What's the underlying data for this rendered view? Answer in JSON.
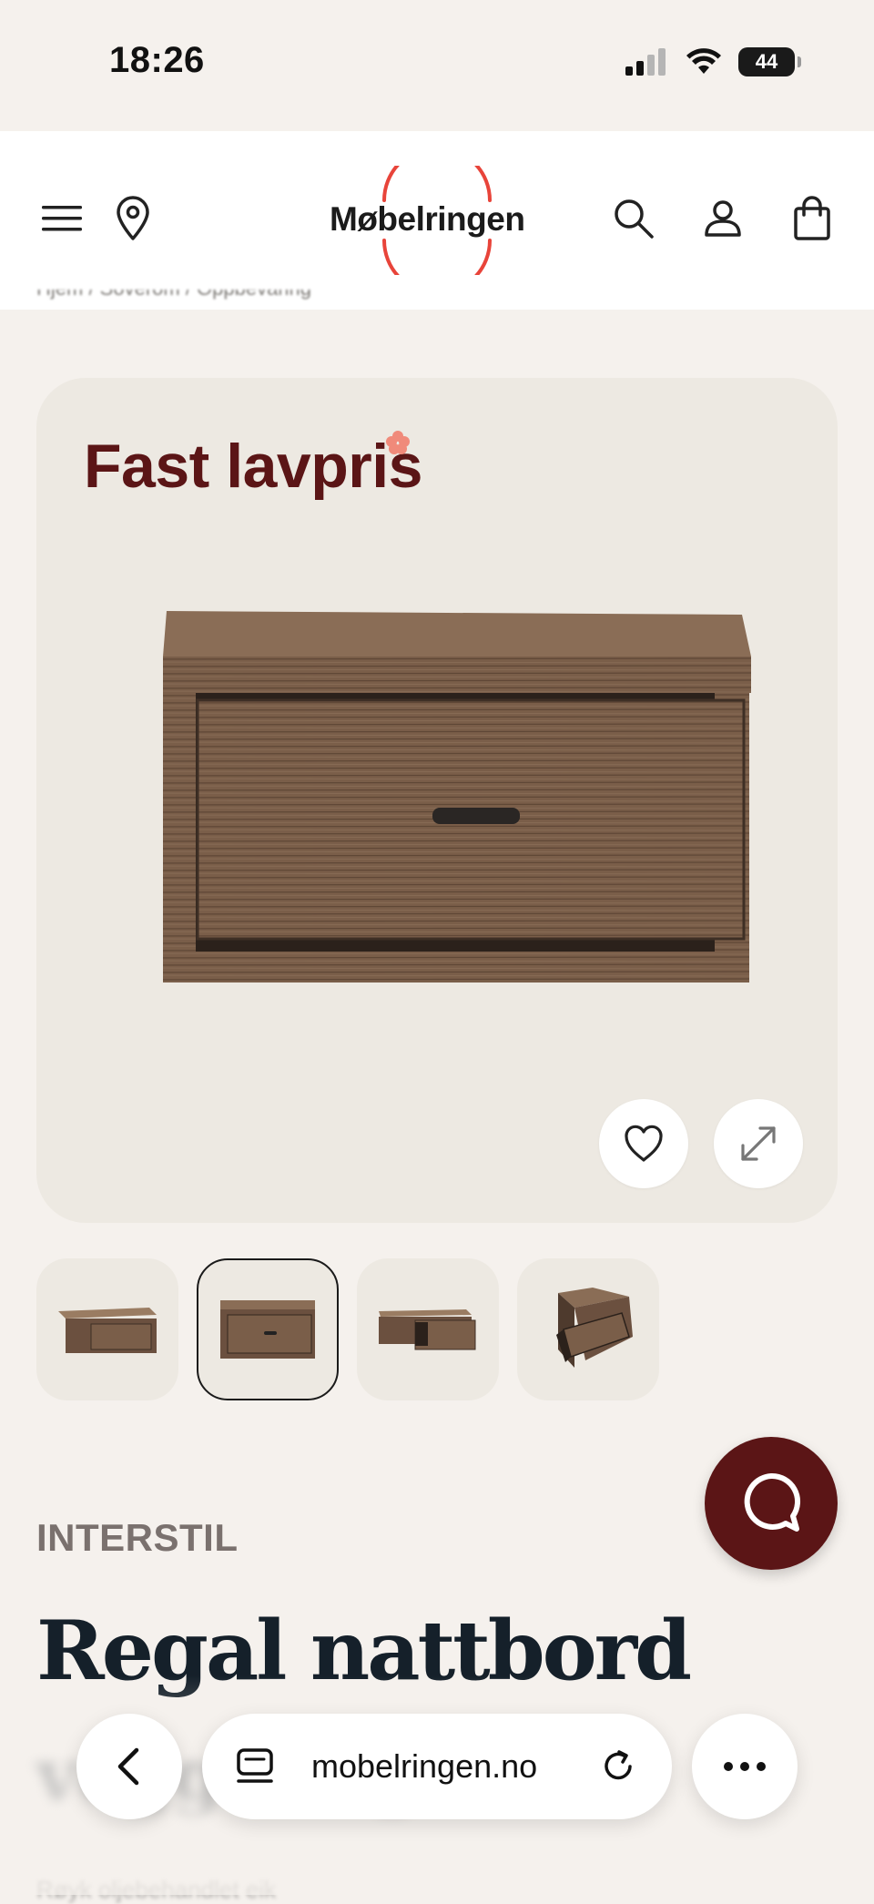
{
  "status_bar": {
    "time": "18:26",
    "battery": "44",
    "icons": [
      "cellular-signal-icon",
      "wifi-icon",
      "battery-icon"
    ]
  },
  "header": {
    "logo_text": "Møbelringen",
    "logo_ring_color": "#e8443a",
    "icons": [
      "menu-icon",
      "location-pin-icon",
      "search-icon",
      "account-icon",
      "shopping-bag-icon"
    ]
  },
  "breadcrumb": {
    "text": "Hjem / Soverom / Oppbevaring"
  },
  "gallery": {
    "badge": "Fast lavpris",
    "badge_color": "#5b1516",
    "badge_dot_color": "#f08a7a",
    "icons": [
      "heart-icon",
      "expand-icon"
    ],
    "thumbnail_count": 4,
    "active_thumbnail": 2
  },
  "chat": {
    "icon": "chat-bubble-icon",
    "color": "#5b1516"
  },
  "product": {
    "brand": "INTERSTIL",
    "title": "Regal nattbord",
    "subtitle": "vegghengt",
    "description": "Røyk oljebehandlet eik"
  },
  "browser": {
    "url": "mobelringen.no",
    "icons": [
      "back-chevron-icon",
      "tab-icon",
      "reload-icon",
      "more-icon"
    ]
  }
}
